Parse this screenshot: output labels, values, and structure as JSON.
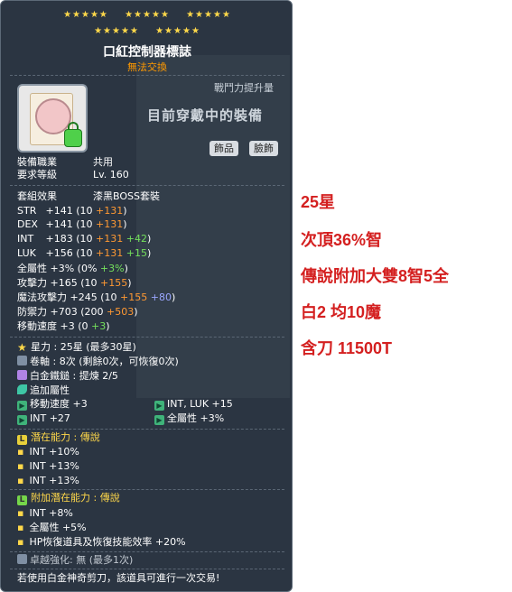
{
  "item": {
    "name": "口紅控制器標誌",
    "trade_status": "無法交換",
    "combat_label": "戰鬥力提升量",
    "equipped_label": "目前穿戴中的裝備",
    "category_buttons": [
      "飾品",
      "臉飾"
    ]
  },
  "stars": [
    "★★★★★",
    "★★★★★",
    "★★★★★",
    "★★★★★",
    "★★★★★"
  ],
  "requirements": {
    "job_label": "裝備職業",
    "job_value": "共用",
    "level_label": "要求等級",
    "level_value": "Lv. 160"
  },
  "set": {
    "label": "套組效果",
    "value": "漆黑BOSS套裝"
  },
  "stats": [
    {
      "label": "STR",
      "total": "+141",
      "base": " (10 ",
      "scroll": "+131",
      "bonus": "",
      "end": ")"
    },
    {
      "label": "DEX",
      "total": "+141",
      "base": " (10 ",
      "scroll": "+131",
      "bonus": "",
      "end": ")"
    },
    {
      "label": "INT",
      "total": "+183",
      "base": " (10 ",
      "scroll": "+131",
      "bonus": " +42",
      "end": ")"
    },
    {
      "label": "LUK",
      "total": "+156",
      "base": " (10 ",
      "scroll": "+131",
      "bonus": " +15",
      "end": ")"
    }
  ],
  "stats2": {
    "allstat": {
      "label": "全屬性",
      "total": " +3%",
      "base": " (0% ",
      "bonus": "+3%",
      "end": ")"
    },
    "att": {
      "label": "攻擊力",
      "total": " +165",
      "base": " (10 ",
      "scroll": "+155",
      "end": ")"
    },
    "matt": {
      "label": "魔法攻擊力",
      "total": " +245",
      "base": " (10 ",
      "scroll": "+155",
      "extra": " +80",
      "end": ")"
    },
    "def": {
      "label": "防禦力",
      "total": " +703",
      "base": " (200 ",
      "scroll": "+503",
      "end": ")"
    },
    "speed": {
      "label": "移動速度",
      "total": " +3",
      "base": " (0 ",
      "bonus": "+3",
      "end": ")"
    }
  },
  "enhance": {
    "starforce": "星力 : 25星 (最多30星)",
    "scroll": "卷軸 : 8次 (剩餘0次，可恢復0次)",
    "hammer": "白金鐵鎚 : 提煉 2/5"
  },
  "flame": {
    "label": "追加屬性",
    "items": [
      "移動速度 +3",
      "INT, LUK  +15",
      "INT  +27",
      "全屬性 +3%"
    ]
  },
  "potential": {
    "label": "潛在能力 : 傳說",
    "lines": [
      "INT +10%",
      "INT +13%",
      "INT +13%"
    ]
  },
  "bonus_potential": {
    "label": "附加潛在能力 : 傳說",
    "lines": [
      "INT +8%",
      "全屬性 +5%",
      "HP恢復道具及恢復技能效率 +20%"
    ]
  },
  "exceptional": "卓越強化: 無 (最多1次)",
  "footer": "若使用白金神奇剪刀，該道具可進行一次交易!",
  "notes": [
    "25星",
    "次頂36%智",
    "傳說附加大雙8智5全",
    "白2 均10魔",
    "含刀 11500T"
  ],
  "colors": {
    "panel": "#2b3542",
    "note_red": "#d42020",
    "star": "#ffd84a",
    "scroll_value": "#ff9933",
    "flame_value": "#74e05c"
  }
}
